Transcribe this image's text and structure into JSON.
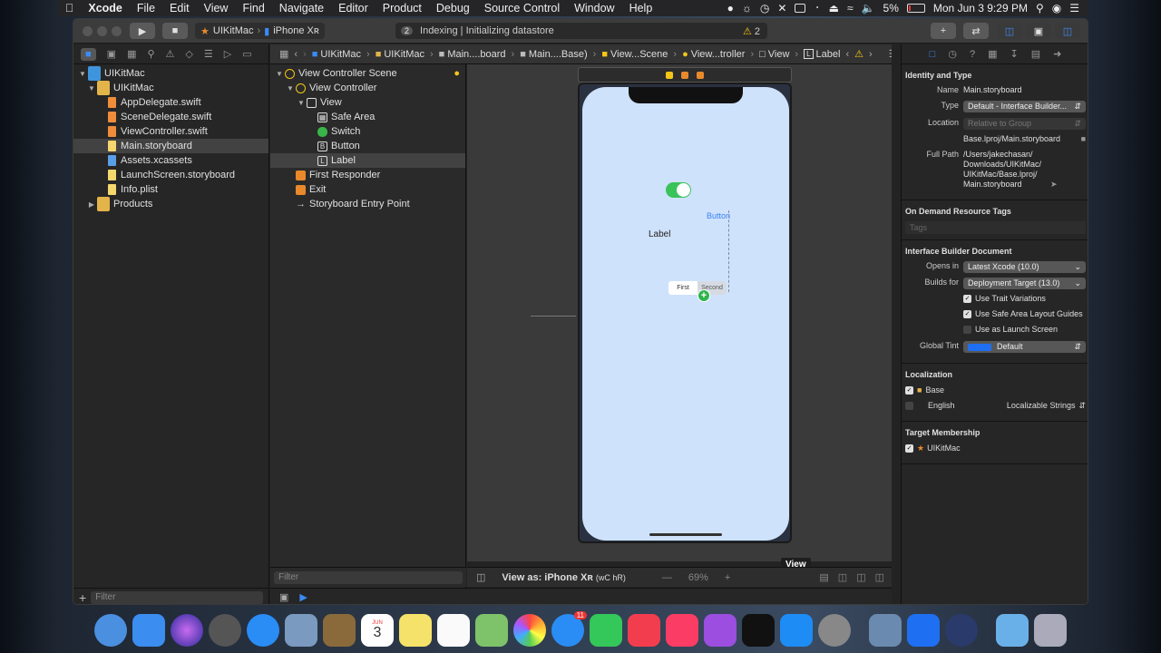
{
  "menubar": {
    "app": "Xcode",
    "items": [
      "File",
      "Edit",
      "View",
      "Find",
      "Navigate",
      "Editor",
      "Product",
      "Debug",
      "Source Control",
      "Window",
      "Help"
    ],
    "battery": "5%",
    "clock": "Mon Jun 3  9:29 PM"
  },
  "toolbar": {
    "scheme": "UIKitMac",
    "device": "iPhone Xʀ",
    "activity_badge": "2",
    "activity": "Indexing | Initializing datastore",
    "warnings": "2"
  },
  "navigator": {
    "tree": [
      {
        "label": "UIKitMac",
        "depth": 0,
        "kind": "project",
        "disclosure": "▼"
      },
      {
        "label": "UIKitMac",
        "depth": 1,
        "kind": "folder",
        "disclosure": "▼"
      },
      {
        "label": "AppDelegate.swift",
        "depth": 2,
        "kind": "swift"
      },
      {
        "label": "SceneDelegate.swift",
        "depth": 2,
        "kind": "swift"
      },
      {
        "label": "ViewController.swift",
        "depth": 2,
        "kind": "swift"
      },
      {
        "label": "Main.storyboard",
        "depth": 2,
        "kind": "storyboard",
        "selected": true
      },
      {
        "label": "Assets.xcassets",
        "depth": 2,
        "kind": "assets"
      },
      {
        "label": "LaunchScreen.storyboard",
        "depth": 2,
        "kind": "storyboard"
      },
      {
        "label": "Info.plist",
        "depth": 2,
        "kind": "plist"
      },
      {
        "label": "Products",
        "depth": 1,
        "kind": "folder",
        "disclosure": "▶"
      }
    ],
    "filter_placeholder": "Filter"
  },
  "jumpbar": [
    "UIKitMac",
    "UIKitMac",
    "Main....board",
    "Main....Base)",
    "View...Scene",
    "View...troller",
    "View",
    "Label"
  ],
  "outline": {
    "rows": [
      {
        "label": "View Controller Scene",
        "depth": 0,
        "icon": "scene",
        "disclosure": "▼"
      },
      {
        "label": "View Controller",
        "depth": 1,
        "icon": "vc",
        "disclosure": "▼"
      },
      {
        "label": "View",
        "depth": 2,
        "icon": "view",
        "disclosure": "▼"
      },
      {
        "label": "Safe Area",
        "depth": 3,
        "icon": "safe"
      },
      {
        "label": "Switch",
        "depth": 3,
        "icon": "switch"
      },
      {
        "label": "Button",
        "depth": 3,
        "icon": "button"
      },
      {
        "label": "Label",
        "depth": 3,
        "icon": "label",
        "selected": true
      },
      {
        "label": "First Responder",
        "depth": 1,
        "icon": "responder"
      },
      {
        "label": "Exit",
        "depth": 1,
        "icon": "exit"
      },
      {
        "label": "Storyboard Entry Point",
        "depth": 1,
        "icon": "entry"
      }
    ],
    "filter_placeholder": "Filter"
  },
  "canvas": {
    "button_title": "Button",
    "label_text": "Label",
    "segment_first": "First",
    "segment_second": "Second",
    "view_tag": "View",
    "view_as": "View as: iPhone Xʀ",
    "size_class": "(wC hR)",
    "zoom": "69%"
  },
  "inspector": {
    "identity_header": "Identity and Type",
    "name_label": "Name",
    "name": "Main.storyboard",
    "type_label": "Type",
    "type": "Default - Interface Builder...",
    "location_label": "Location",
    "location": "Relative to Group",
    "location_file": "Base.lproj/Main.storyboard",
    "fullpath_label": "Full Path",
    "full_path": "/Users/jakechasan/ Downloads/UIKitMac/ UIKitMac/Base.lproj/ Main.storyboard",
    "odr_header": "On Demand Resource Tags",
    "tags_placeholder": "Tags",
    "ibdoc_header": "Interface Builder Document",
    "opens_in_label": "Opens in",
    "opens_in": "Latest Xcode (10.0)",
    "builds_for_label": "Builds for",
    "builds_for": "Deployment Target (13.0)",
    "use_trait": "Use Trait Variations",
    "use_safe": "Use Safe Area Layout Guides",
    "use_launch": "Use as Launch Screen",
    "tint_label": "Global Tint",
    "tint": "Default",
    "loc_header": "Localization",
    "loc_base": "Base",
    "loc_english": "English",
    "loc_english_kind": "Localizable Strings",
    "target_header": "Target Membership",
    "target": "UIKitMac"
  },
  "dock": {
    "calendar_month": "JUN",
    "calendar_day": "3",
    "messages_badge": "11"
  },
  "colors": {
    "accent": "#3b8bf5",
    "switch_on": "#39c35a",
    "canvas_bg": "#cfe2fb"
  }
}
